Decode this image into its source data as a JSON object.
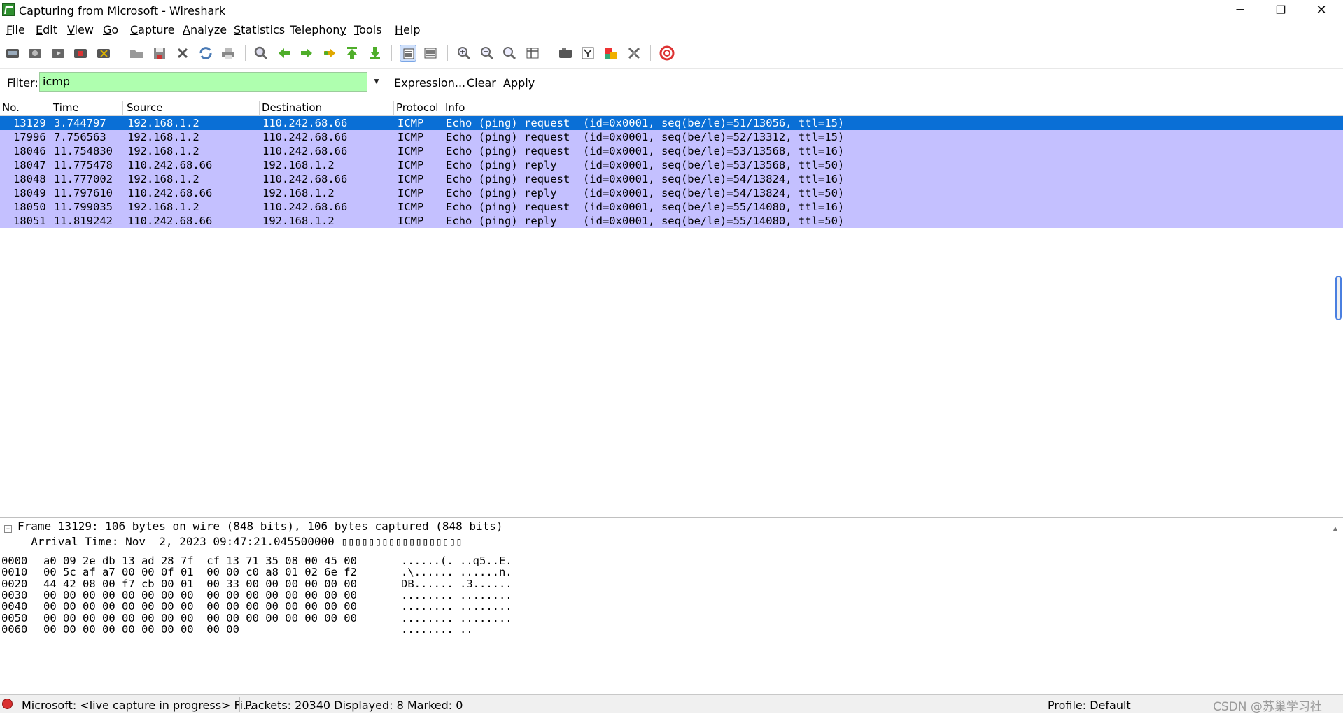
{
  "window": {
    "title": "Capturing from Microsoft - Wireshark",
    "minimize": "─",
    "maximize": "❐",
    "close": "✕"
  },
  "menu": [
    {
      "pre": "",
      "u": "F",
      "post": "ile"
    },
    {
      "pre": "",
      "u": "E",
      "post": "dit"
    },
    {
      "pre": "",
      "u": "V",
      "post": "iew"
    },
    {
      "pre": "",
      "u": "G",
      "post": "o"
    },
    {
      "pre": "",
      "u": "C",
      "post": "apture"
    },
    {
      "pre": "",
      "u": "A",
      "post": "nalyze"
    },
    {
      "pre": "",
      "u": "S",
      "post": "tatistics"
    },
    {
      "pre": "Telephon",
      "u": "y",
      "post": ""
    },
    {
      "pre": "",
      "u": "T",
      "post": "ools"
    },
    {
      "pre": "",
      "u": "H",
      "post": "elp"
    }
  ],
  "toolbar": [
    "interfaces-icon",
    "options-icon",
    "start-capture-icon",
    "stop-capture-icon",
    "restart-capture-icon",
    "open-file-icon",
    "save-file-icon",
    "close-file-icon",
    "reload-icon",
    "print-icon",
    "find-packet-icon",
    "go-back-icon",
    "go-forward-icon",
    "go-to-packet-icon",
    "first-packet-icon",
    "last-packet-icon",
    "colorize-icon",
    "auto-scroll-icon",
    "zoom-in-icon",
    "zoom-out-icon",
    "normal-size-icon",
    "resize-columns-icon",
    "capture-filters-icon",
    "display-filters-icon",
    "coloring-rules-icon",
    "preferences-icon",
    "help-icon"
  ],
  "filter": {
    "label": "Filter:",
    "value": "icmp",
    "expression": "Expression...",
    "clear": "Clear",
    "apply": "Apply"
  },
  "packet_list": {
    "columns": [
      "No.",
      "Time",
      "Source",
      "Destination",
      "Protocol",
      "Info"
    ],
    "rows": [
      {
        "no": "13129",
        "time": "3.744797",
        "source": "192.168.1.2",
        "destination": "110.242.68.66",
        "protocol": "ICMP",
        "info": "Echo (ping) request  (id=0x0001, seq(be/le)=51/13056, ttl=15)",
        "selected": true
      },
      {
        "no": "17996",
        "time": "7.756563",
        "source": "192.168.1.2",
        "destination": "110.242.68.66",
        "protocol": "ICMP",
        "info": "Echo (ping) request  (id=0x0001, seq(be/le)=52/13312, ttl=15)",
        "selected": false
      },
      {
        "no": "18046",
        "time": "11.754830",
        "source": "192.168.1.2",
        "destination": "110.242.68.66",
        "protocol": "ICMP",
        "info": "Echo (ping) request  (id=0x0001, seq(be/le)=53/13568, ttl=16)",
        "selected": false
      },
      {
        "no": "18047",
        "time": "11.775478",
        "source": "110.242.68.66",
        "destination": "192.168.1.2",
        "protocol": "ICMP",
        "info": "Echo (ping) reply    (id=0x0001, seq(be/le)=53/13568, ttl=50)",
        "selected": false
      },
      {
        "no": "18048",
        "time": "11.777002",
        "source": "192.168.1.2",
        "destination": "110.242.68.66",
        "protocol": "ICMP",
        "info": "Echo (ping) request  (id=0x0001, seq(be/le)=54/13824, ttl=16)",
        "selected": false
      },
      {
        "no": "18049",
        "time": "11.797610",
        "source": "110.242.68.66",
        "destination": "192.168.1.2",
        "protocol": "ICMP",
        "info": "Echo (ping) reply    (id=0x0001, seq(be/le)=54/13824, ttl=50)",
        "selected": false
      },
      {
        "no": "18050",
        "time": "11.799035",
        "source": "192.168.1.2",
        "destination": "110.242.68.66",
        "protocol": "ICMP",
        "info": "Echo (ping) request  (id=0x0001, seq(be/le)=55/14080, ttl=16)",
        "selected": false
      },
      {
        "no": "18051",
        "time": "11.819242",
        "source": "110.242.68.66",
        "destination": "192.168.1.2",
        "protocol": "ICMP",
        "info": "Echo (ping) reply    (id=0x0001, seq(be/le)=55/14080, ttl=50)",
        "selected": false
      }
    ]
  },
  "detail": {
    "expander": "−",
    "frame": "Frame 13129: 106 bytes on wire (848 bits), 106 bytes captured (848 bits)",
    "arrival": "  Arrival Time: Nov  2, 2023 09:47:21.045500000 ▯▯▯▯▯▯▯▯▯▯▯▯▯▯▯▯▯▯",
    "scroll_up": "▲"
  },
  "bytes": [
    {
      "offset": "0000",
      "hex": "a0 09 2e db 13 ad 28 7f  cf 13 71 35 08 00 45 00",
      "ascii": "......(. ..q5..E."
    },
    {
      "offset": "0010",
      "hex": "00 5c af a7 00 00 0f 01  00 00 c0 a8 01 02 6e f2",
      "ascii": ".\\...... ......n."
    },
    {
      "offset": "0020",
      "hex": "44 42 08 00 f7 cb 00 01  00 33 00 00 00 00 00 00",
      "ascii": "DB...... .3......"
    },
    {
      "offset": "0030",
      "hex": "00 00 00 00 00 00 00 00  00 00 00 00 00 00 00 00",
      "ascii": "........ ........"
    },
    {
      "offset": "0040",
      "hex": "00 00 00 00 00 00 00 00  00 00 00 00 00 00 00 00",
      "ascii": "........ ........"
    },
    {
      "offset": "0050",
      "hex": "00 00 00 00 00 00 00 00  00 00 00 00 00 00 00 00",
      "ascii": "........ ........"
    },
    {
      "offset": "0060",
      "hex": "00 00 00 00 00 00 00 00  00 00",
      "ascii": "........ .."
    }
  ],
  "status": {
    "capture": "Microsoft: <live capture in progress> Fi...",
    "packets": "Packets: 20340 Displayed: 8 Marked: 0",
    "profile": "Profile: Default"
  },
  "watermark": "CSDN @苏巢学习社"
}
